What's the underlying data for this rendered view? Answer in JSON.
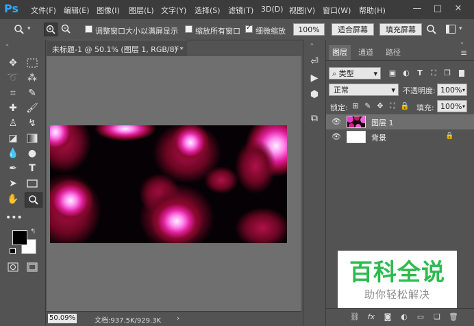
{
  "app": {
    "logo": "Ps"
  },
  "menu": [
    "文件(F)",
    "编辑(E)",
    "图像(I)",
    "图层(L)",
    "文字(Y)",
    "选择(S)",
    "滤镜(T)",
    "3D(D)",
    "视图(V)",
    "窗口(W)",
    "帮助(H)"
  ],
  "window_controls": [
    "—",
    "□",
    "✕"
  ],
  "options": {
    "resize_windows_label": "调整窗口大小以满屏显示",
    "resize_windows_checked": false,
    "zoom_all_label": "缩放所有窗口",
    "zoom_all_checked": false,
    "scrubby_zoom_label": "细微缩放",
    "scrubby_zoom_checked": true,
    "zoom_value": "100%",
    "fit_screen_label": "适合屏幕",
    "fill_screen_label": "填充屏幕"
  },
  "document": {
    "tab_title": "未标题-1 @ 50.1% (图层 1, RGB/8) *",
    "close": "×",
    "zoom": "50.09%",
    "doc_size": "文档:937.5K/929.3K"
  },
  "layers_panel": {
    "tabs": [
      "图层",
      "通道",
      "路径"
    ],
    "active_tab": 0,
    "filter_kind": "类型",
    "blend_mode": "正常",
    "opacity_label": "不透明度:",
    "opacity_value": "100%",
    "lock_label": "锁定:",
    "fill_label": "填充:",
    "fill_value": "100%",
    "layers": [
      {
        "name": "图层 1",
        "selected": true,
        "locked": false
      },
      {
        "name": "背景",
        "selected": false,
        "locked": true
      }
    ]
  },
  "watermark": {
    "main": "百科全说",
    "sub": "助你轻松解决"
  },
  "colors": {
    "menu_bg": "#3c3c3c",
    "panel_bg": "#535353",
    "canvas_bg": "#6f6f6f",
    "accent": "#31a8ff",
    "watermark_green": "#2dbb4e"
  }
}
